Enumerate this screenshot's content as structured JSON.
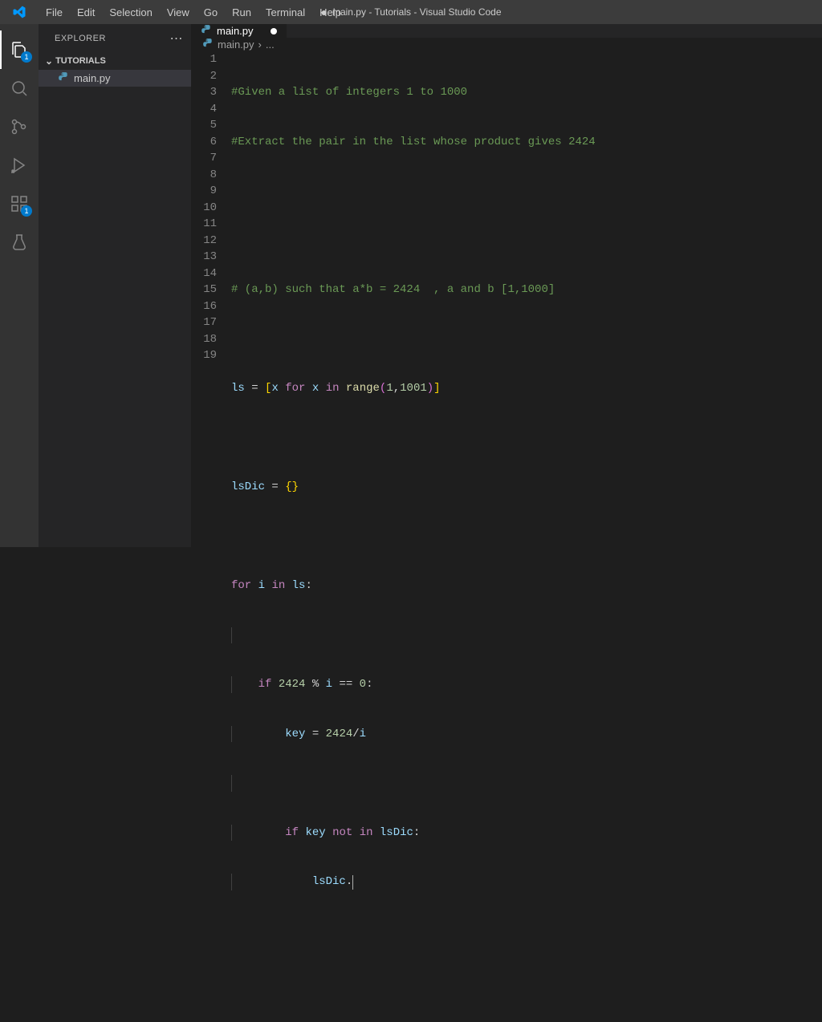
{
  "title_bar": {
    "menus": [
      "File",
      "Edit",
      "Selection",
      "View",
      "Go",
      "Run",
      "Terminal",
      "Help"
    ],
    "title_dirty_dot": "●",
    "title": "main.py - Tutorials - Visual Studio Code"
  },
  "activity_bar": {
    "explorer_badge": "1",
    "ext_badge": "1"
  },
  "sidebar": {
    "header": "EXPLORER",
    "section": "TUTORIALS",
    "file": "main.py"
  },
  "tab": {
    "label": "main.py"
  },
  "breadcrumb": {
    "file": "main.py",
    "sep": "›",
    "more": "..."
  },
  "gutter": [
    "1",
    "2",
    "3",
    "4",
    "5",
    "6",
    "7",
    "8",
    "9",
    "10",
    "11",
    "12",
    "13",
    "14",
    "15",
    "16",
    "17",
    "18",
    "19"
  ],
  "code": {
    "l1": "#Given a list of integers 1 to 1000",
    "l2": "#Extract the pair in the list whose product gives 2424",
    "l5": "# (a,b) such that a*b = 2424  , a and b [1,1000]",
    "l7_ls": "ls",
    "l7_eq": " = ",
    "l7_x1": "x",
    "l7_for": "for",
    "l7_x2": "x",
    "l7_in": "in",
    "l7_range": "range",
    "l7_n1": "1",
    "l7_n2": "1001",
    "l9_lsdic": "lsDic",
    "l9_eq": " = ",
    "l11_for": "for",
    "l11_i": "i",
    "l11_in": "in",
    "l11_ls": "ls",
    "l13_if": "if",
    "l13_n": "2424",
    "l13_mod": " % ",
    "l13_i": "i",
    "l13_eq": " == ",
    "l13_z": "0",
    "l14_key": "key",
    "l14_eq": " = ",
    "l14_n": "2424",
    "l14_div": "/",
    "l14_i": "i",
    "l16_if": "if",
    "l16_key": "key",
    "l16_not": "not",
    "l16_in": "in",
    "l16_lsdic": "lsDic",
    "l17_lsdic": "lsDic",
    "l17_dot": "."
  }
}
